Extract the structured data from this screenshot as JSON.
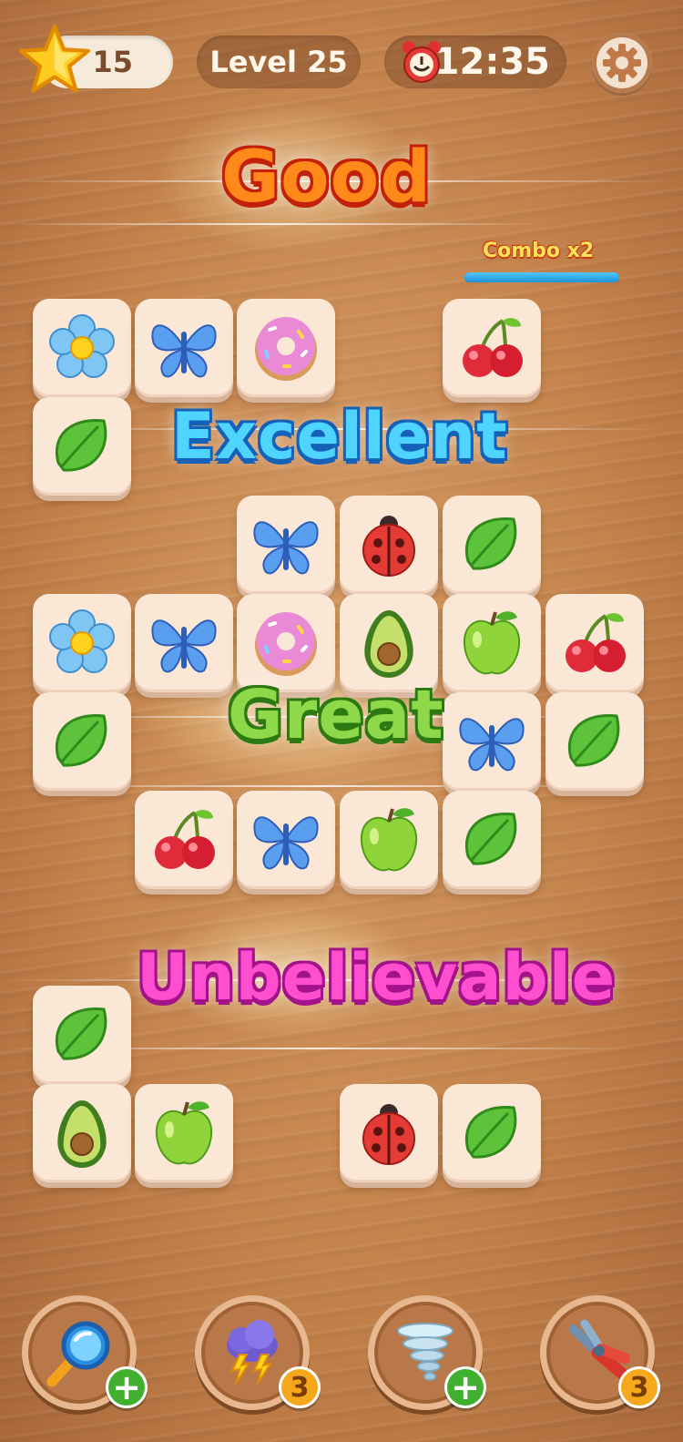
{
  "hud": {
    "stars": "15",
    "level": "Level 25",
    "timer": "12:35"
  },
  "combo": {
    "label": "Combo x2",
    "progress": 1.0
  },
  "praise": {
    "good": "Good",
    "excellent": "Excellent",
    "great": "Great",
    "unbelievable": "Unbelievable"
  },
  "colors": {
    "good": "#ff8a1a",
    "excellent": "#4fd3ff",
    "great": "#8fd84a",
    "unbelievable": "#ff4fd0"
  },
  "tiles": [
    {
      "icon": "flower"
    },
    {
      "icon": "butterfly"
    },
    {
      "icon": "donut"
    },
    {
      "icon": "cherry"
    },
    {
      "icon": "leaf"
    },
    {
      "icon": "butterfly"
    },
    {
      "icon": "ladybug"
    },
    {
      "icon": "leaf"
    },
    {
      "icon": "flower"
    },
    {
      "icon": "butterfly"
    },
    {
      "icon": "donut"
    },
    {
      "icon": "avocado"
    },
    {
      "icon": "apple"
    },
    {
      "icon": "cherry"
    },
    {
      "icon": "leaf"
    },
    {
      "icon": "butterfly"
    },
    {
      "icon": "leaf"
    },
    {
      "icon": "cherry"
    },
    {
      "icon": "butterfly"
    },
    {
      "icon": "apple"
    },
    {
      "icon": "leaf"
    },
    {
      "icon": "leaf"
    },
    {
      "icon": "avocado"
    },
    {
      "icon": "apple"
    },
    {
      "icon": "ladybug"
    },
    {
      "icon": "leaf"
    }
  ],
  "boosters": [
    {
      "name": "magnifier",
      "badge": "+"
    },
    {
      "name": "storm-cloud",
      "badge": "3"
    },
    {
      "name": "tornado",
      "badge": "+"
    },
    {
      "name": "pliers",
      "badge": "3"
    }
  ]
}
